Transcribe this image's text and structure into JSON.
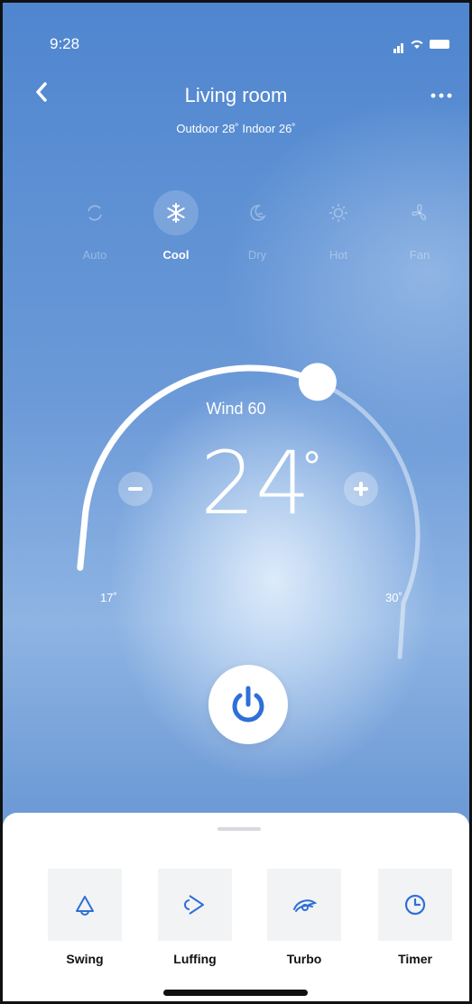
{
  "status_bar": {
    "time": "9:28"
  },
  "header": {
    "title": "Living room",
    "subtitle": "Outdoor 28˚ Indoor 26˚",
    "back_icon": "chevron-left-icon",
    "more_icon": "more-icon"
  },
  "modes": [
    {
      "label": "Auto",
      "icon": "auto-icon",
      "active": false
    },
    {
      "label": "Cool",
      "icon": "snowflake-icon",
      "active": true
    },
    {
      "label": "Dry",
      "icon": "dry-icon",
      "active": false
    },
    {
      "label": "Hot",
      "icon": "sun-icon",
      "active": false
    },
    {
      "label": "Fan",
      "icon": "fan-icon",
      "active": false
    }
  ],
  "thermostat": {
    "wind_text": "Wind 60",
    "temperature": "24",
    "degree_symbol": "°",
    "min_label": "17˚",
    "max_label": "30˚",
    "minus_symbol": "−",
    "plus_symbol": "+",
    "set_value": 24,
    "min_value": 17,
    "max_value": 30
  },
  "power": {
    "icon": "power-icon"
  },
  "functions": [
    {
      "label": "Swing",
      "icon": "swing-icon"
    },
    {
      "label": "Luffing",
      "icon": "luffing-icon"
    },
    {
      "label": "Turbo",
      "icon": "turbo-icon"
    },
    {
      "label": "Timer",
      "icon": "clock-icon"
    }
  ],
  "colors": {
    "accent_blue": "#2f6fd6",
    "background_top": "#4f86cf"
  }
}
